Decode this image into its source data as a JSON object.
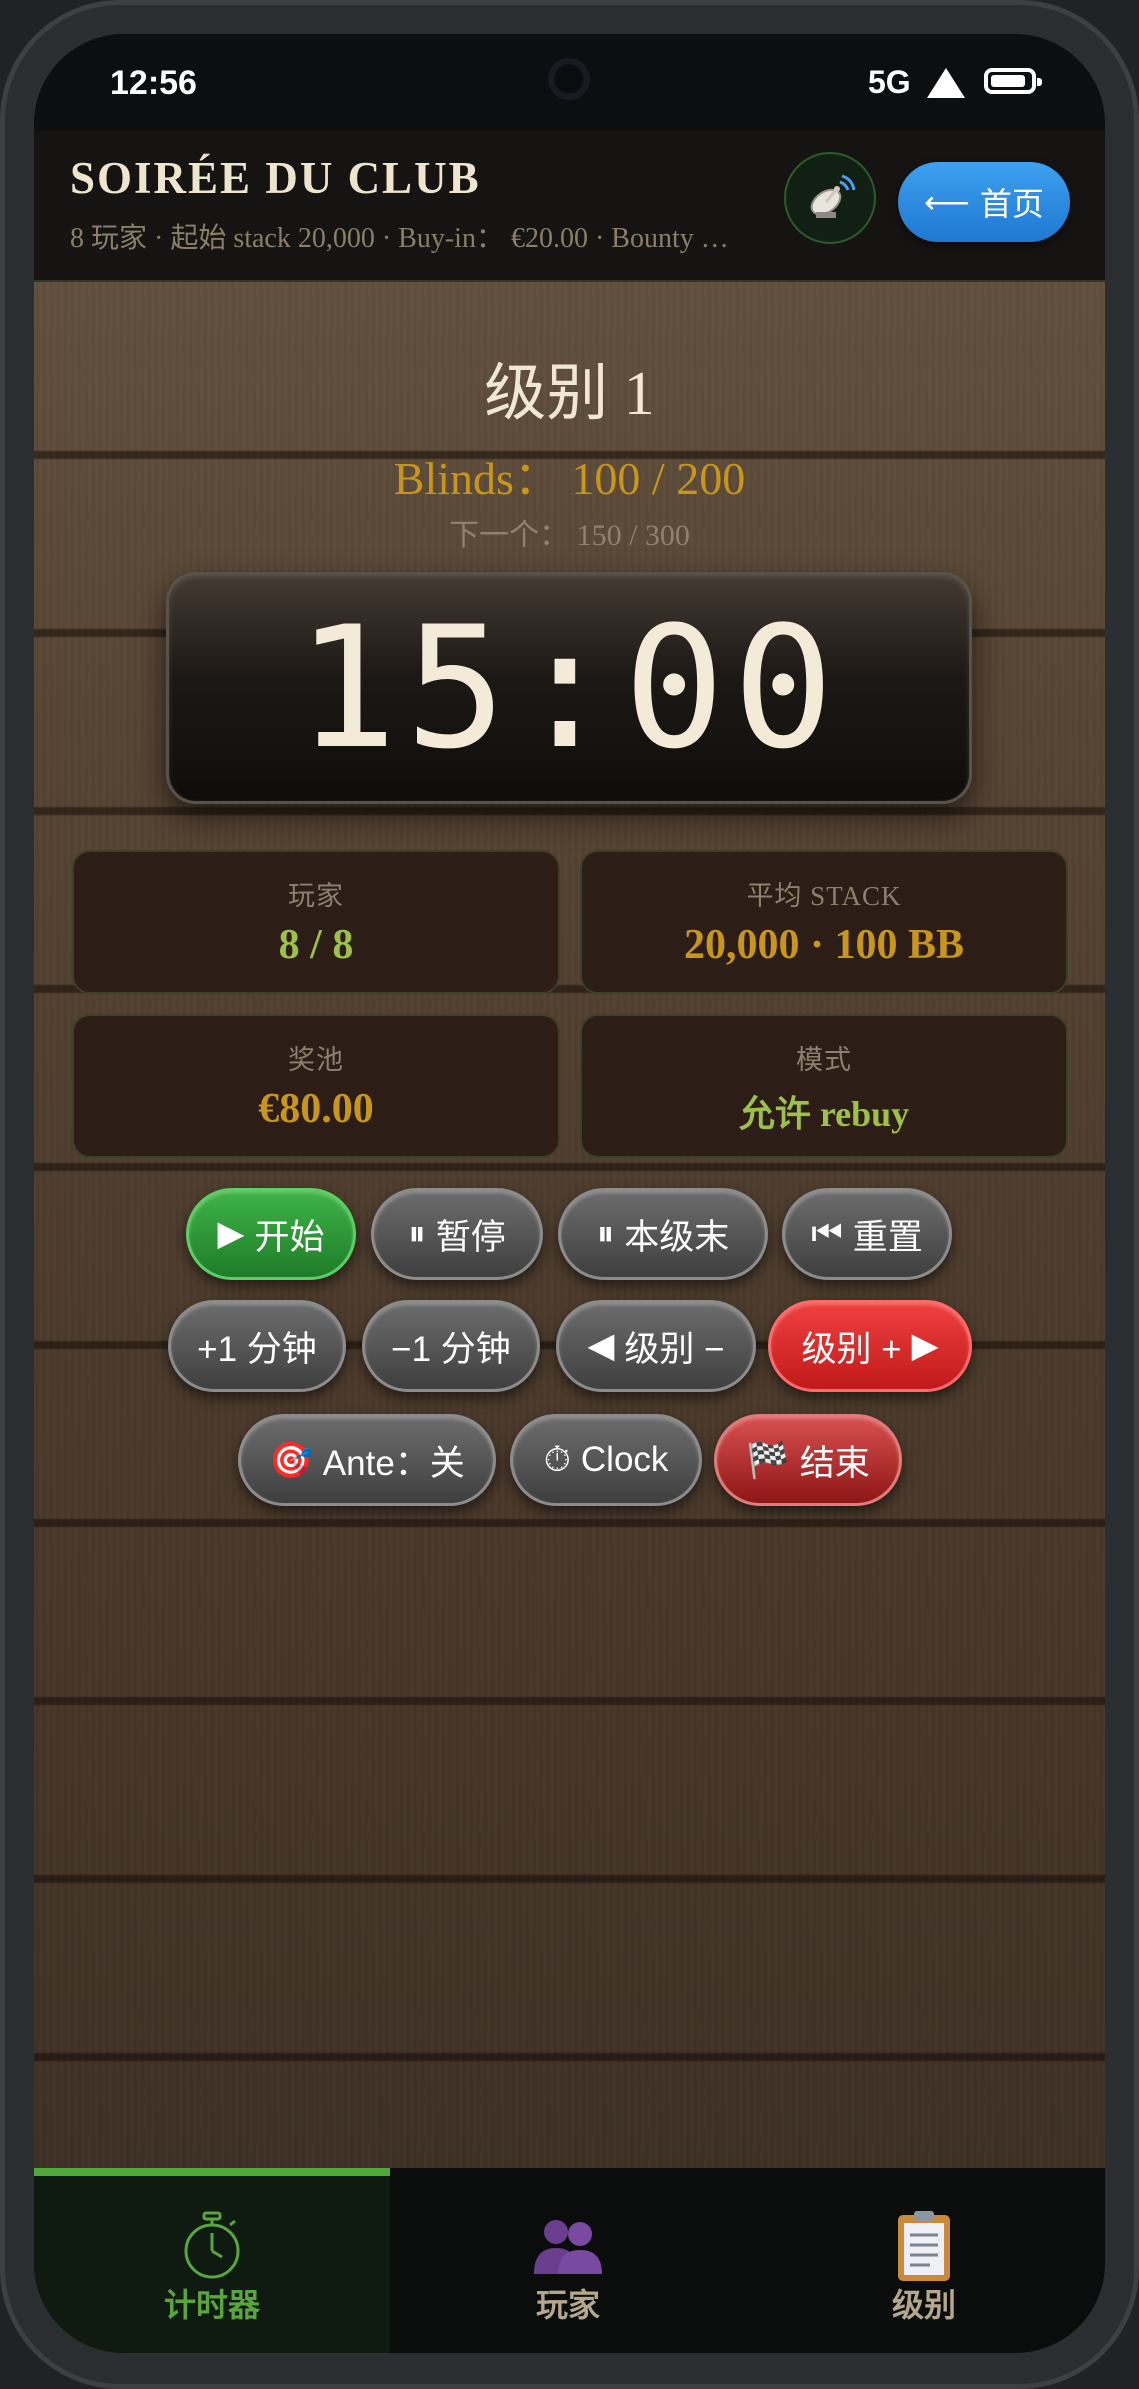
{
  "status": {
    "time": "12:56",
    "network": "5G"
  },
  "header": {
    "title": "SOIRÉE DU CLUB",
    "subtitle": "8 玩家 · 起始 stack 20,000 · Buy-in： €20.00 · Bounty …",
    "home_label": "首页",
    "home_arrow": "⟵"
  },
  "level": {
    "title": "级别 1",
    "blinds": "Blinds：  100 / 200",
    "next": "下一个：  150 / 300"
  },
  "timer": {
    "value": "15:00"
  },
  "stats": {
    "players": {
      "label": "玩家",
      "value": "8 / 8"
    },
    "avg_stack": {
      "label": "平均 STACK",
      "value": "20,000 · 100 BB"
    },
    "pot": {
      "label": "奖池",
      "value": "€80.00"
    },
    "mode": {
      "label": "模式",
      "value": "允许 rebuy"
    }
  },
  "controls": {
    "start": {
      "icon": "▶",
      "label": "开始"
    },
    "pause": {
      "icon": "⏸",
      "label": "暂停"
    },
    "level_end": {
      "icon": "⏸",
      "label": "本级末"
    },
    "reset": {
      "icon": "⏮",
      "label": "重置"
    },
    "plus_minute": "+1 分钟",
    "minus_minute": "−1 分钟",
    "level_prev": {
      "icon": "◀",
      "label": "级别 −"
    },
    "level_next": {
      "icon": "▶",
      "label": "级别 +"
    },
    "ante": {
      "icon": "🎯",
      "label": "Ante：关"
    },
    "clock": {
      "icon": "⏱",
      "label": "Clock"
    },
    "finish": {
      "icon": "🏁",
      "label": "结束"
    }
  },
  "tabs": [
    {
      "label": "计时器",
      "icon": "stopwatch-icon",
      "active": true,
      "color": "#5aa63e"
    },
    {
      "label": "玩家",
      "icon": "players-icon",
      "active": false,
      "color": "#b5a78e"
    },
    {
      "label": "级别",
      "icon": "clipboard-icon",
      "active": false,
      "color": "#b5a78e"
    }
  ],
  "colors": {
    "accent_gold": "#c8961d",
    "value_green": "#9cc04a",
    "home_blue": "#2f8fe6",
    "active_green": "#4ea83a"
  }
}
